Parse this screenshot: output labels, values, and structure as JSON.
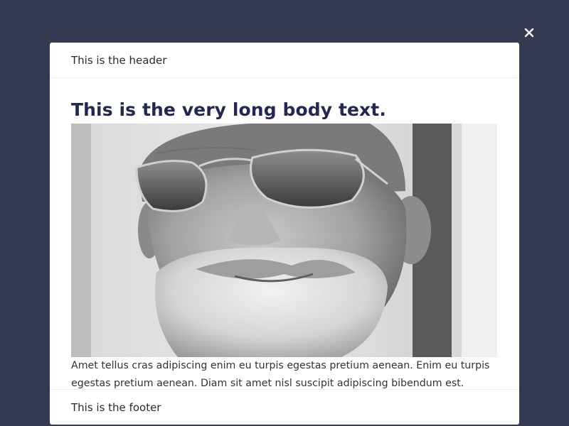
{
  "overlay": {
    "background": "#363a51"
  },
  "close_button": {
    "icon": "close-icon",
    "glyph": "✕"
  },
  "modal": {
    "header_text": "This is the header",
    "body_title": "This is the very long body text.",
    "image": {
      "kind": "photo",
      "alt": "Black and white portrait of an older man with a white beard, sunglasses and a knit cap"
    },
    "body_paragraph": "Amet tellus cras adipiscing enim eu turpis egestas pretium aenean. Enim eu turpis egestas pretium aenean. Diam sit amet nisl suscipit adipiscing bibendum est.",
    "footer_text": "This is the footer"
  },
  "colors": {
    "title": "#232850",
    "text": "#333333",
    "modal_background": "#ffffff"
  }
}
